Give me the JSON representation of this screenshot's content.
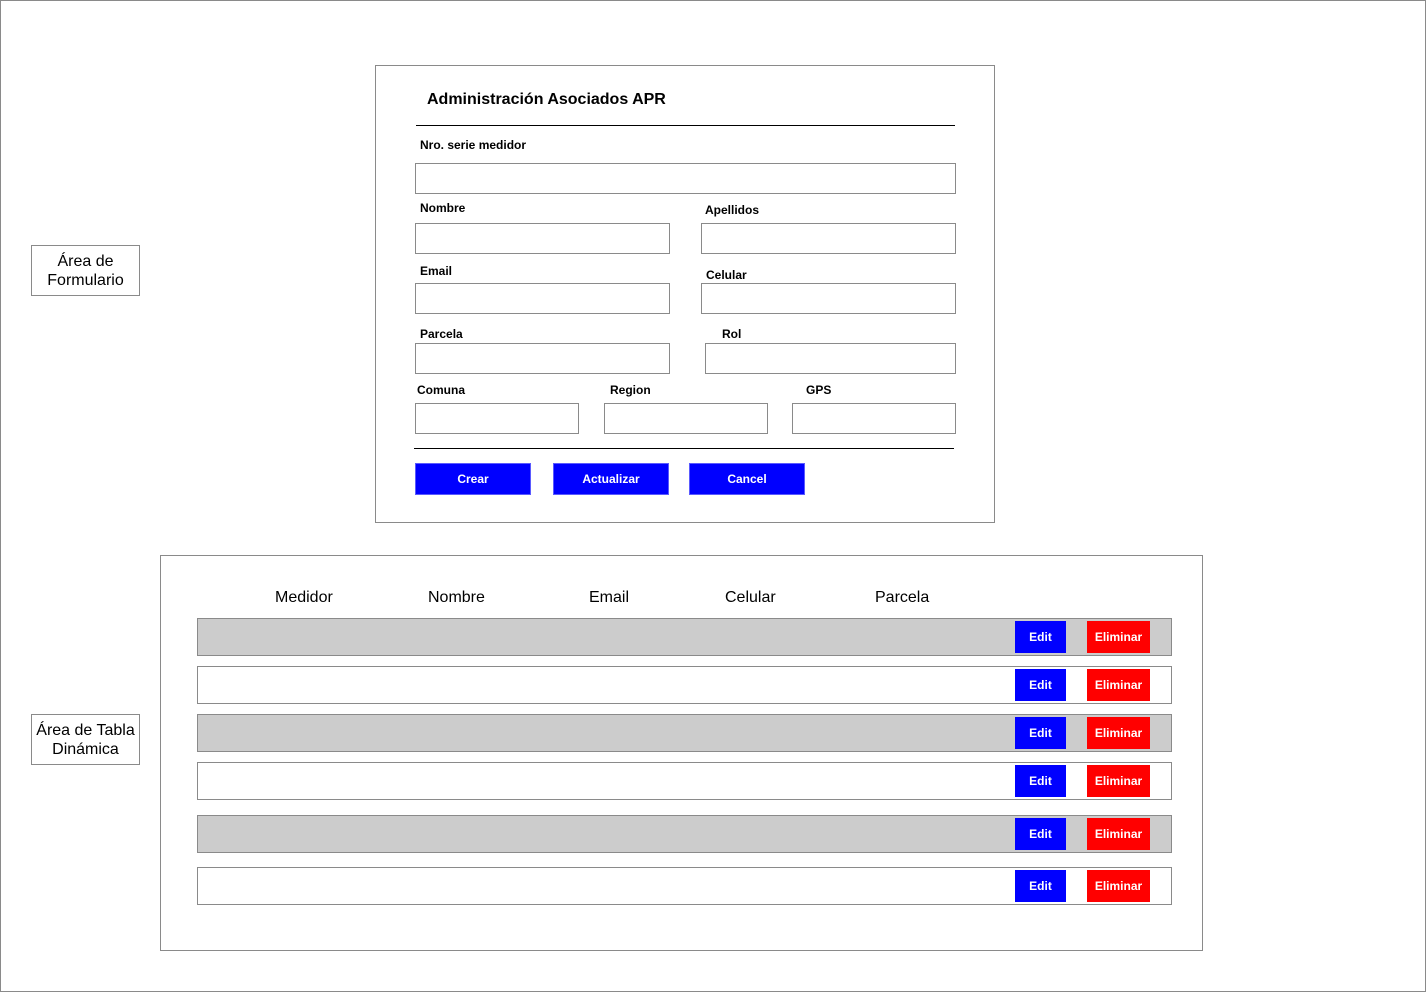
{
  "side_labels": {
    "form_area": "Área de\nFormulario",
    "table_area": "Área de Tabla\nDinámica"
  },
  "form": {
    "title": "Administración Asociados APR",
    "labels": {
      "meter_serial": "Nro. serie medidor",
      "name": "Nombre",
      "surname": "Apellidos",
      "email": "Email",
      "phone": "Celular",
      "parcel": "Parcela",
      "role": "Rol",
      "commune": "Comuna",
      "region": "Region",
      "gps": "GPS"
    },
    "buttons": {
      "create": "Crear",
      "update": "Actualizar",
      "cancel": "Cancel"
    }
  },
  "table": {
    "headers": [
      "Medidor",
      "Nombre",
      "Email",
      "Celular",
      "Parcela"
    ],
    "rows": [
      {
        "edit": "Edit",
        "delete": "Eliminar"
      },
      {
        "edit": "Edit",
        "delete": "Eliminar"
      },
      {
        "edit": "Edit",
        "delete": "Eliminar"
      },
      {
        "edit": "Edit",
        "delete": "Eliminar"
      },
      {
        "edit": "Edit",
        "delete": "Eliminar"
      },
      {
        "edit": "Edit",
        "delete": "Eliminar"
      }
    ]
  },
  "colors": {
    "primary_button": "#0000ff",
    "danger_button": "#ff0000",
    "row_alt": "#cccccc",
    "border": "#8a8a8a"
  }
}
